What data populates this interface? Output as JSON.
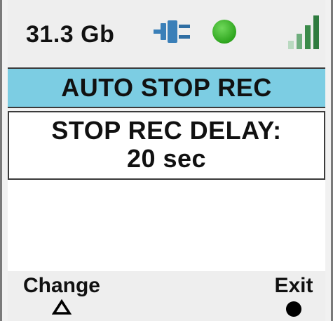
{
  "status_bar": {
    "storage": "31.3 Gb",
    "power_icon": "plug-icon",
    "status_icon": "green-dot-icon",
    "status_color": "#2ea51e",
    "signal_icon": "signal-bars-icon",
    "signal_color": "#3a8a4a"
  },
  "title_bar": {
    "title": "AUTO STOP REC",
    "background": "#7ccde3"
  },
  "setting": {
    "label": "STOP REC DELAY:",
    "value": "20 sec"
  },
  "softkeys": {
    "left": {
      "label": "Change",
      "icon": "triangle-up-icon"
    },
    "right": {
      "label": "Exit",
      "icon": "filled-circle-icon"
    }
  }
}
